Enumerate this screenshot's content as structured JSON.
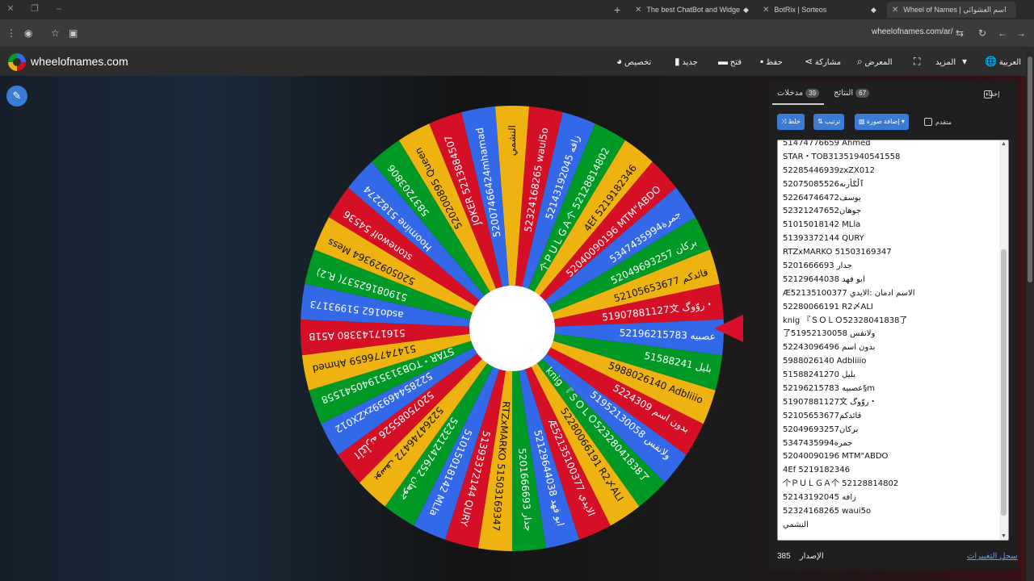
{
  "browser": {
    "tabs": [
      {
        "label": "The best ChatBot and Widgets"
      },
      {
        "label": "BotRix | Sorteos"
      },
      {
        "label": "Wheel of Names | اسم العشوائي"
      }
    ],
    "url": "wheelofnames.com/ar/"
  },
  "header": {
    "brand": "wheelofnames.com",
    "menu": {
      "customize": "تخصيص",
      "new": "جديد",
      "open": "فتح",
      "save": "حفظ",
      "share": "مشاركة",
      "gallery": "المعرض",
      "more": "المزيد",
      "language": "العربية"
    }
  },
  "wheel": {
    "colors": [
      "#eeb211",
      "#d50f25",
      "#3369e8",
      "#009925"
    ],
    "labels": [
      "النشمي",
      "52324168265 waui5o",
      "52143192045 زافه",
      "个ＰＵＬＧＡ个 52128814802",
      "4Ef 5219182346",
      "52040090196 MTM\"ABDO",
      "5347435994جمرة",
      "52049693257 بركان",
      "52105653677 قائدكم",
      "51907881127文 روّوگ・",
      "52196215783 عصبيه",
      "51588241 بليل",
      "5988026140 Adbliiio",
      "5224309 بدون اسم",
      "51952130058 ولانفس",
      "knig 『ＳＯＬＯ52328041838了",
      "52280066191 R2〆ALI",
      "Æ52135100377 الايدي",
      "52129644038 ابو فهد",
      "5201666693 جدار",
      "RTZxMARKO 51503169347",
      "51393372144 QURY",
      "51015018142 MLla",
      "52321247652 جوهان",
      "52264746472 يوسف",
      "52075085526 ٱڵػأرنه",
      "52285446939zxZX012",
      "STAR・TOB31351940541558",
      "51474776659 Ahmed",
      "51617143380 A51B",
      "asdo162 51993173",
      "51908162537( R.2)",
      "52050929364 Mess",
      "stonewolf 54536",
      "Hoomine 5182274",
      "5837203806",
      "520200895 Queen",
      "JOKER 5213884507",
      "520074664​24mhamad"
    ]
  },
  "panel": {
    "tabs": {
      "entries_label": "مدخلات",
      "entries_count": "39",
      "results_label": "النتائج",
      "results_count": "67"
    },
    "hide_label": "إخفاء",
    "shuffle_label": "خلط",
    "sort_label": "ترتيب",
    "add_image_label": "إضافة صورة",
    "advanced_label": "متقدم",
    "entries": [
      "51474776659 Ahmed",
      "STAR・TOB31351940541558",
      "52285446939zxZX012",
      "ٱڵػأرنه52075085526",
      "يوسف52264746472",
      "جوهان52321247652",
      "51015018142 MLla",
      "51393372144 QURY",
      "RTZxMARKO 51503169347",
      "جدار 5201666693",
      "ابو فهد 52129644038",
      "Æ52135100377 الاسم ادمان :الايدي",
      "52280066191 R2〆ALI",
      "knig 『ＳＯＬＯ52328041838了",
      "了51952130058 ولانفس",
      "بدون اسم 52243096496",
      "5988026140 Adbliiio",
      "بليل 51588241270",
      "52196215783 عصبيه§m",
      "51907881127文 روّوگ・",
      "قائدكم52105653677",
      "بركان52049693257",
      "جمرة5347435994",
      "52040090196 MTM\"ABDO",
      "4Ef 5219182346",
      "个ＰＵＬＧＡ个 52128814802",
      "زافه 52143192045",
      "52324168265 waui5o",
      "النشمي"
    ],
    "version_label": "الإصدار",
    "version_number": "385",
    "changelog_label": "سجل التغييرات"
  }
}
